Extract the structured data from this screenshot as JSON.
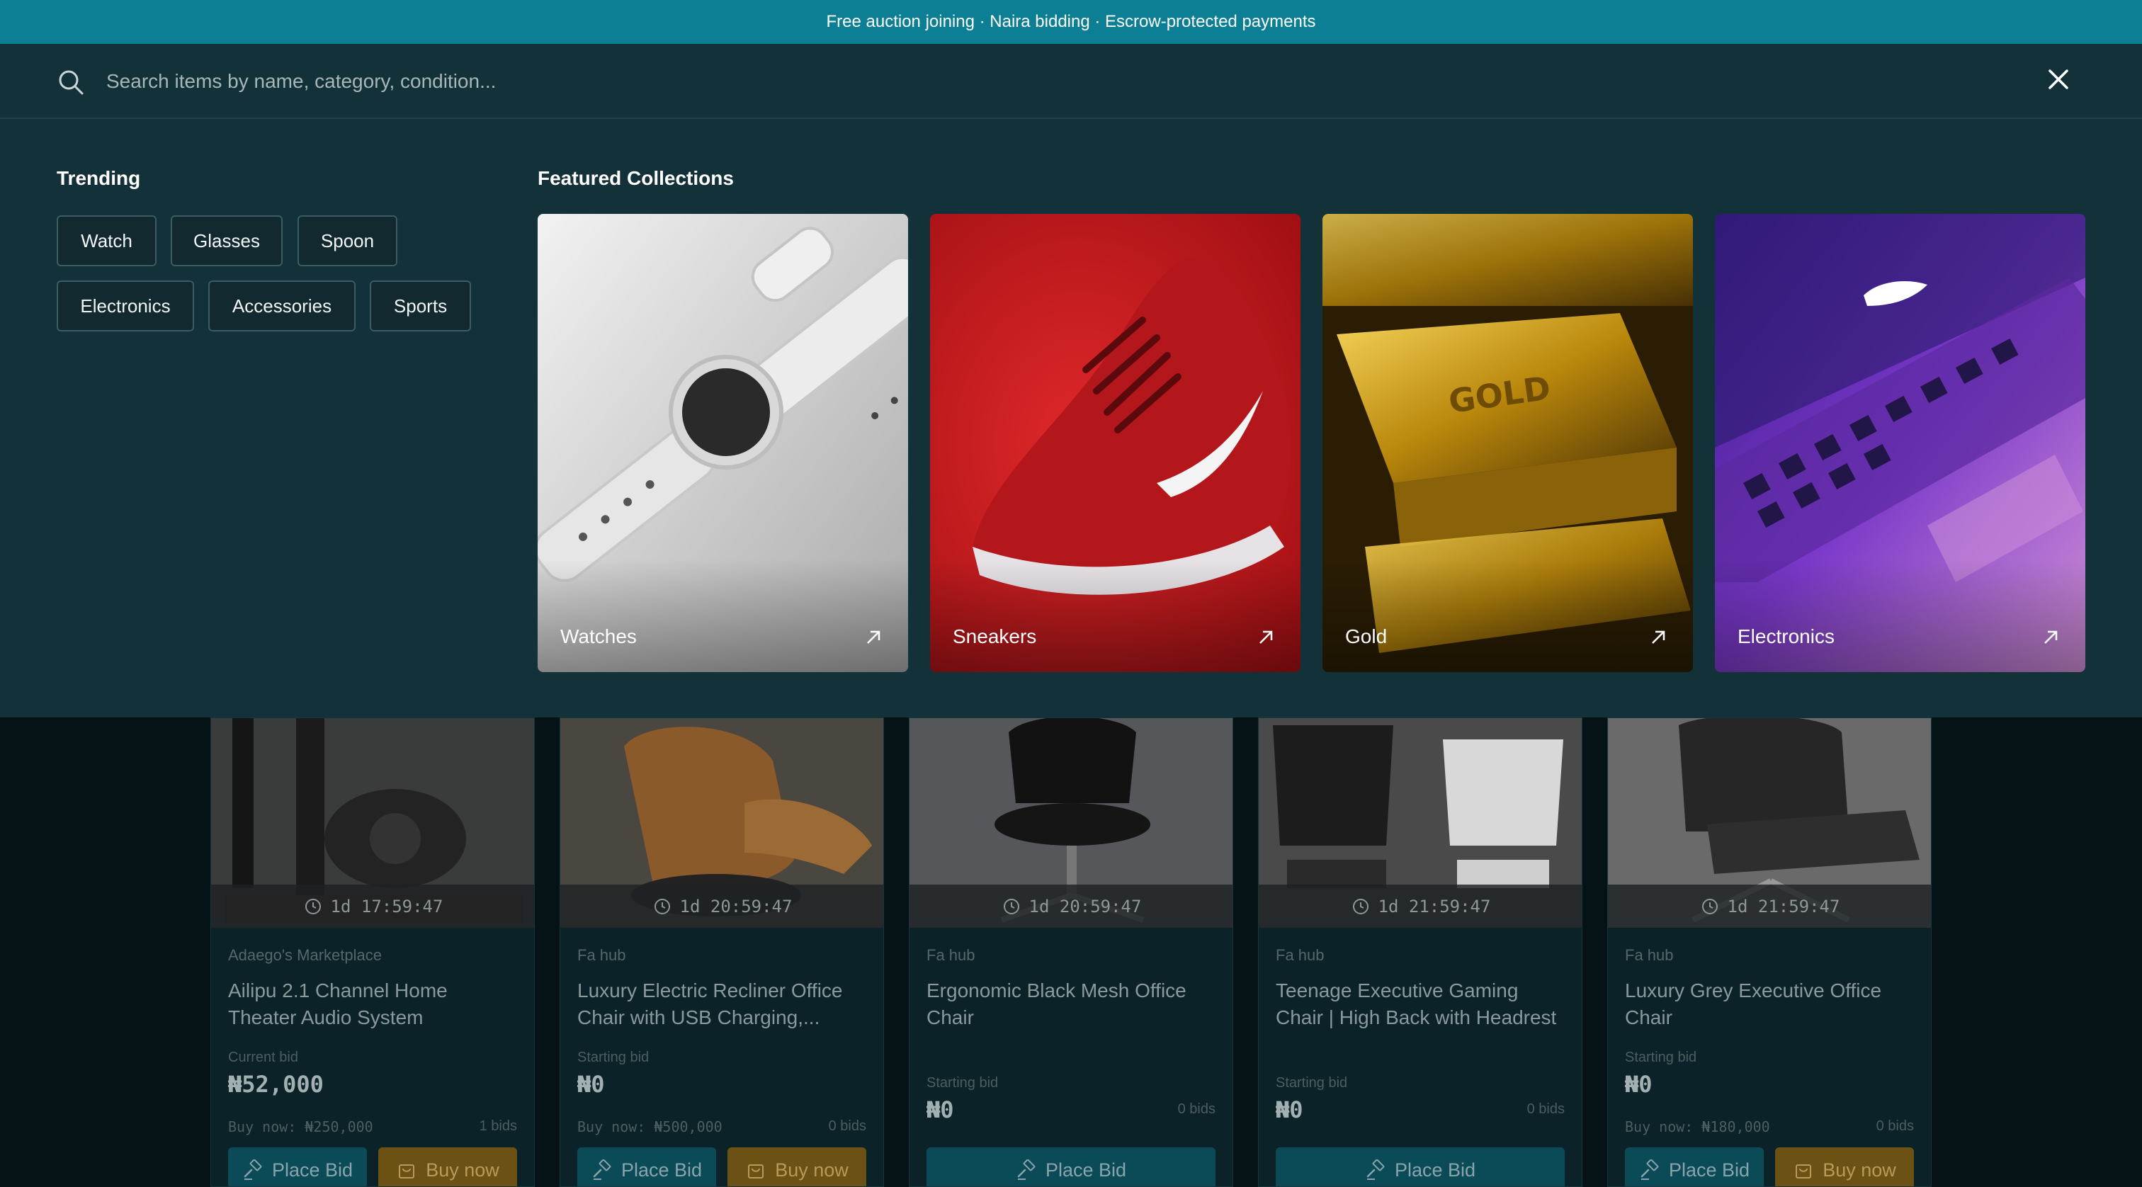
{
  "banner": {
    "text": "Free auction joining · Naira bidding · Escrow-protected payments"
  },
  "search": {
    "placeholder": "Search items by name, category, condition..."
  },
  "trending": {
    "title": "Trending",
    "chips": [
      "Watch",
      "Glasses",
      "Spoon",
      "Electronics",
      "Accessories",
      "Sports"
    ]
  },
  "featured": {
    "title": "Featured Collections",
    "collections": [
      {
        "label": "Watches"
      },
      {
        "label": "Sneakers"
      },
      {
        "label": "Gold"
      },
      {
        "label": "Electronics"
      }
    ]
  },
  "listings": [
    {
      "timer": "1d 17:59:47",
      "seller": "Adaego's Marketplace",
      "title": "Ailipu 2.1 Channel Home Theater Audio System",
      "bid_label": "Current bid",
      "bid_amount": "₦52,000",
      "buy_now": "Buy now: ₦250,000",
      "bids": "1 bids",
      "place_bid": "Place Bid",
      "buy_label": "Buy now"
    },
    {
      "timer": "1d 20:59:47",
      "seller": "Fa hub",
      "title": "Luxury Electric Recliner Office Chair with USB Charging,...",
      "bid_label": "Starting bid",
      "bid_amount": "₦0",
      "buy_now": "Buy now: ₦500,000",
      "bids": "0 bids",
      "place_bid": "Place Bid",
      "buy_label": "Buy now"
    },
    {
      "timer": "1d 20:59:47",
      "seller": "Fa hub",
      "title": "Ergonomic Black Mesh Office Chair",
      "bid_label": "Starting bid",
      "bid_amount": "₦0",
      "bids": "0 bids",
      "place_bid": "Place Bid"
    },
    {
      "timer": "1d 21:59:47",
      "seller": "Fa hub",
      "title": "Teenage Executive Gaming Chair | High Back with Headrest",
      "bid_label": "Starting bid",
      "bid_amount": "₦0",
      "bids": "0 bids",
      "place_bid": "Place Bid"
    },
    {
      "timer": "1d 21:59:47",
      "seller": "Fa hub",
      "title": "Luxury Grey Executive Office Chair",
      "bid_label": "Starting bid",
      "bid_amount": "₦0",
      "buy_now": "Buy now: ₦180,000",
      "bids": "0 bids",
      "place_bid": "Place Bid",
      "buy_label": "Buy now"
    }
  ],
  "colors": {
    "banner": "#0c7f95",
    "panel": "#133138",
    "bid_button": "#0a4b57",
    "buy_button": "#6b5214"
  }
}
